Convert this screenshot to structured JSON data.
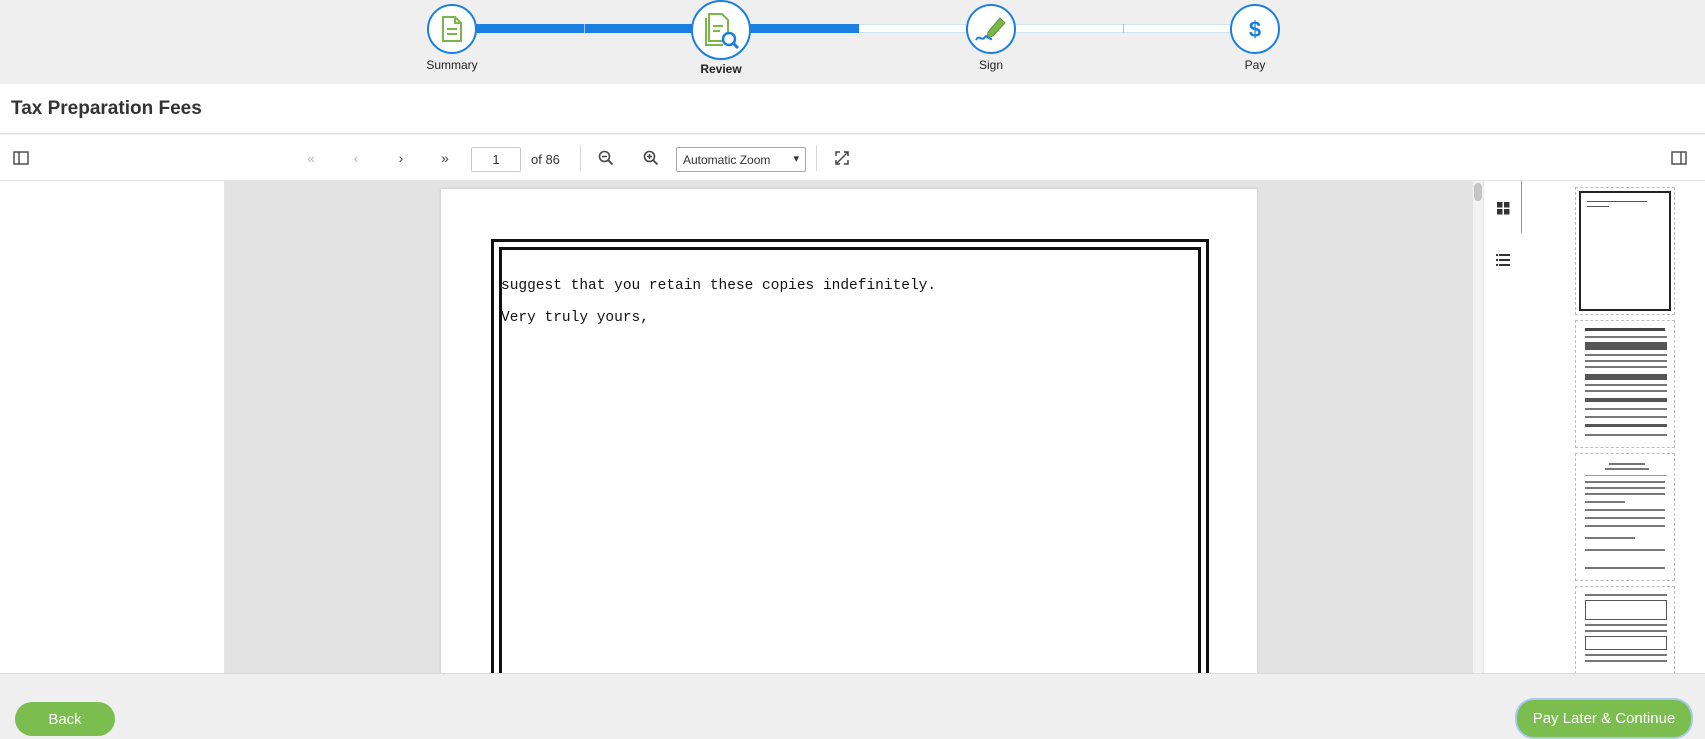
{
  "stepper": {
    "steps": [
      {
        "label": "Summary",
        "icon": "document-icon",
        "state": "complete"
      },
      {
        "label": "Review",
        "icon": "document-search-icon",
        "state": "active"
      },
      {
        "label": "Sign",
        "icon": "pen-sign-icon",
        "state": "upcoming"
      },
      {
        "label": "Pay",
        "icon": "dollar-icon",
        "state": "upcoming"
      }
    ]
  },
  "title": "Tax Preparation Fees",
  "toolbar": {
    "sidebar_toggle_icon": "sidebar-toggle-icon",
    "first_page_icon": "double-chevron-left-icon",
    "prev_page_icon": "chevron-left-icon",
    "next_page_icon": "chevron-right-icon",
    "last_page_icon": "double-chevron-right-icon",
    "page_number": "1",
    "page_total": "of 86",
    "zoom_out_icon": "zoom-out-icon",
    "zoom_in_icon": "zoom-in-icon",
    "zoom_value": "Automatic Zoom",
    "fullscreen_icon": "expand-icon",
    "right_panel_icon": "panel-toggle-icon"
  },
  "document": {
    "lines": [
      "suggest that you retain these copies indefinitely.",
      "Very truly yours,"
    ]
  },
  "sidebar": {
    "thumbnails_icon": "grid-icon",
    "outline_icon": "list-icon",
    "thumbnail_count": 4
  },
  "footer": {
    "back_label": "Back",
    "continue_label": "Pay Later & Continue"
  },
  "colors": {
    "accent_blue": "#1a7fe0",
    "accent_green": "#7bbd4f"
  }
}
